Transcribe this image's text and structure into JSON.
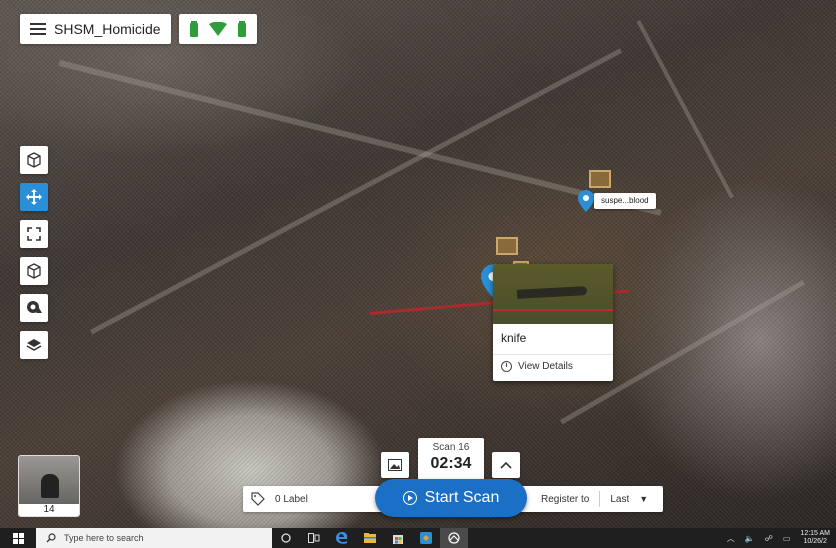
{
  "app": {
    "project_title": "SHSM_Homicide"
  },
  "tags": [
    {
      "label": "suspe...blood"
    }
  ],
  "evidence_card": {
    "name": "knife",
    "details_label": "View Details"
  },
  "thumbnail": {
    "count": "14"
  },
  "scan": {
    "label": "Scan 16",
    "time": "02:34",
    "start_label": "Start Scan"
  },
  "bottom_bar": {
    "label_count": "0 Label",
    "register_label": "Register to",
    "register_value": "Last"
  },
  "taskbar": {
    "search_placeholder": "Type here to search",
    "clock_time": "12:15 AM",
    "clock_date": "10/26/2"
  },
  "colors": {
    "accent": "#2a8fd6",
    "start_scan": "#1b6fc4",
    "status_green": "#2f9e3a",
    "pin_blue": "#2a8fd6"
  },
  "icons": {
    "menu": "hamburger-icon",
    "status": [
      "battery-icon",
      "wifi-icon",
      "battery-icon"
    ],
    "tools": [
      "cube-outline-icon",
      "move-icon",
      "expand-icon",
      "cube-icon",
      "eye-icon",
      "layers-icon"
    ]
  }
}
